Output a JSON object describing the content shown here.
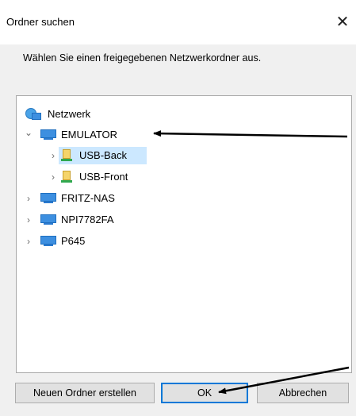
{
  "window": {
    "title": "Ordner suchen",
    "close_glyph": "✕"
  },
  "prompt": "Wählen Sie einen freigegebenen Netzwerkordner aus.",
  "tree": {
    "root": {
      "label": "Netzwerk",
      "icon": "network-icon"
    },
    "items": [
      {
        "label": "EMULATOR",
        "icon": "computer-icon",
        "expanded": true,
        "chevron": "⌄"
      },
      {
        "label": "USB-Back",
        "icon": "drive-icon",
        "selected": true,
        "chevron": "›"
      },
      {
        "label": "USB-Front",
        "icon": "drive-icon",
        "chevron": "›"
      },
      {
        "label": "FRITZ-NAS",
        "icon": "computer-icon",
        "chevron": "›"
      },
      {
        "label": "NPI7782FA",
        "icon": "computer-icon",
        "chevron": "›"
      },
      {
        "label": "P645",
        "icon": "computer-icon",
        "chevron": "›"
      }
    ]
  },
  "buttons": {
    "new_folder": "Neuen Ordner erstellen",
    "ok": "OK",
    "cancel": "Abbrechen"
  },
  "colors": {
    "selection": "#cce8ff",
    "default_button_border": "#0078d7",
    "annotation_arrow": "#000000"
  }
}
